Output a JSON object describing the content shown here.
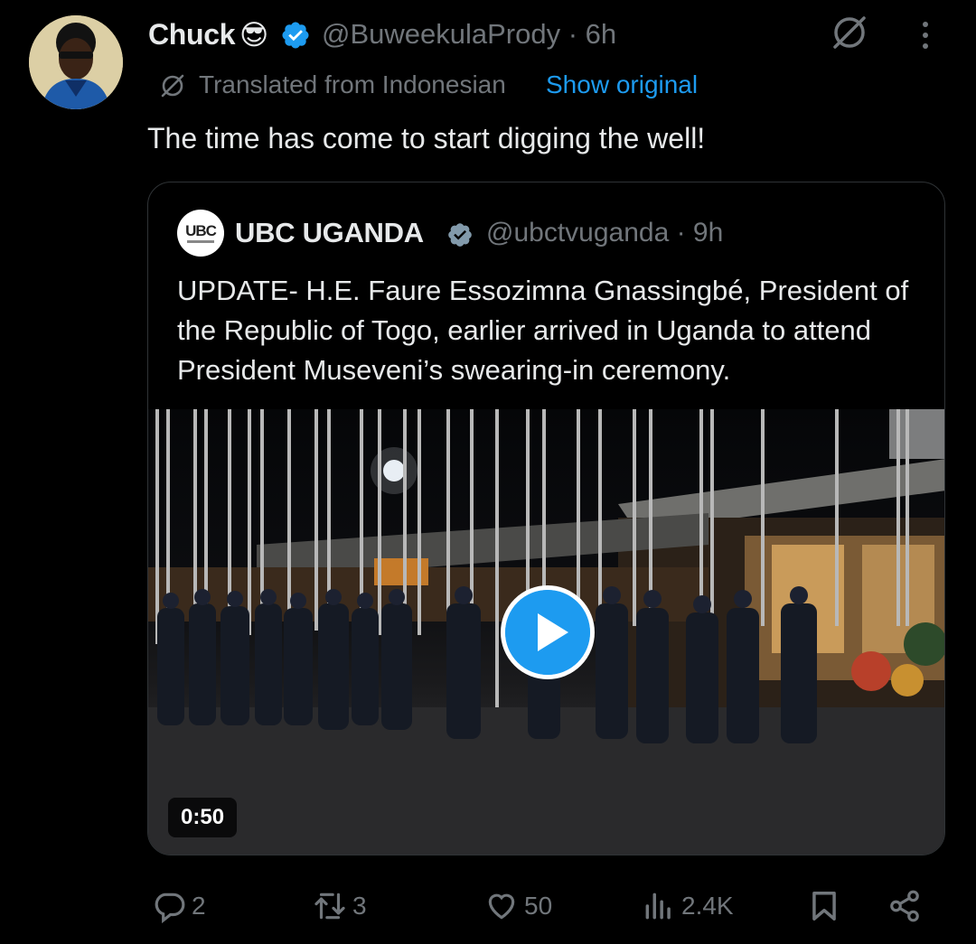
{
  "author": {
    "name": "Chuck",
    "emoji": "😎",
    "handle": "@BuweekulaPrody",
    "time": "· 6h",
    "verified_icon": "verified-badge-icon",
    "colors": {
      "verified": "#1d9bf0"
    }
  },
  "translation": {
    "label": "Translated from Indonesian",
    "show_original": "Show original"
  },
  "tweet_text": "The time has come to start digging the well!",
  "quoted": {
    "logo_text": "UBC",
    "name": "UBC UGANDA",
    "handle": "@ubctvuganda",
    "time": "· 9h",
    "text": "UPDATE- H.E. Faure Essozimna Gnassingbé, President of the Republic of Togo, earlier arrived in Uganda to attend President Museveni’s swearing-in ceremony.",
    "video": {
      "duration": "0:50",
      "play_icon": "play-icon"
    }
  },
  "actions": {
    "replies": "2",
    "reposts": "3",
    "likes": "50",
    "views": "2.4K"
  },
  "colors": {
    "background": "#000000",
    "text": "#e7e9ea",
    "muted": "#71767b",
    "accent": "#1d9bf0",
    "border": "#2f3336"
  }
}
